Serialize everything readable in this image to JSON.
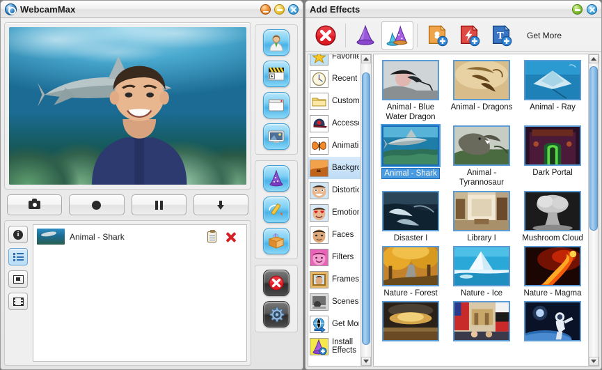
{
  "main_window": {
    "title": "WebcamMax",
    "logo_icon": "webcam-logo-icon",
    "window_buttons": [
      {
        "name": "minimize",
        "icon": "minimize-icon",
        "color": "#f0933a"
      },
      {
        "name": "maximize",
        "icon": "maximize-icon",
        "color": "#f3ce4c"
      },
      {
        "name": "close",
        "icon": "close-icon",
        "color": "#56b3e8"
      }
    ],
    "transport_buttons": [
      {
        "name": "snapshot",
        "icon": "camera-icon"
      },
      {
        "name": "record",
        "icon": "record-circle-icon"
      },
      {
        "name": "pause",
        "icon": "pause-icon"
      },
      {
        "name": "save",
        "icon": "arrow-down-icon"
      }
    ],
    "list_tabs": [
      {
        "name": "info",
        "icon": "info-icon",
        "selected": false
      },
      {
        "name": "effects-list",
        "icon": "list-icon",
        "selected": true
      },
      {
        "name": "pictures",
        "icon": "image-icon",
        "selected": false
      },
      {
        "name": "videos",
        "icon": "film-icon",
        "selected": false
      }
    ],
    "active_effects": [
      {
        "name": "Animal - Shark",
        "thumb": "shark-thumb",
        "actions": [
          "properties-icon",
          "delete-icon"
        ]
      }
    ],
    "rail_groups": [
      {
        "name": "sources",
        "buttons": [
          {
            "name": "webcam-source",
            "icon": "person-icon"
          },
          {
            "name": "video-source",
            "icon": "film-clapper-icon"
          },
          {
            "name": "window-source",
            "icon": "window-icon"
          },
          {
            "name": "desktop-source",
            "icon": "desktop-picture-icon"
          }
        ]
      },
      {
        "name": "effects-tools",
        "buttons": [
          {
            "name": "add-effects",
            "icon": "wizard-hat-icon"
          },
          {
            "name": "doodle",
            "icon": "pencil-icon"
          },
          {
            "name": "my-effects",
            "icon": "gift-box-icon"
          }
        ]
      },
      {
        "name": "app-actions",
        "buttons": [
          {
            "name": "exit",
            "icon": "red-x-icon"
          },
          {
            "name": "settings",
            "icon": "gear-icon"
          }
        ]
      }
    ],
    "preview": {
      "description": "Webcam preview with underwater shark background effect applied"
    }
  },
  "effects_panel": {
    "title": "Add Effects",
    "window_buttons": [
      {
        "name": "collapse",
        "icon": "collapse-icon",
        "color": "#8fc93c"
      },
      {
        "name": "close",
        "icon": "close-icon",
        "color": "#56b3e8"
      }
    ],
    "toolbar": {
      "buttons": [
        {
          "name": "remove-all-effects",
          "icon": "red-x-icon",
          "selected": false
        },
        {
          "name": "single-effect-mode",
          "icon": "purple-hat-icon",
          "selected": false
        },
        {
          "name": "multi-effect-mode",
          "icon": "multi-hat-icon",
          "selected": true
        },
        {
          "name": "add-picture",
          "icon": "add-picture-icon",
          "selected": false
        },
        {
          "name": "add-flash",
          "icon": "add-flash-icon",
          "selected": false
        },
        {
          "name": "add-text",
          "icon": "add-text-icon",
          "selected": false
        }
      ],
      "get_more_label": "Get More"
    },
    "categories": [
      {
        "label": "Favorites",
        "icon": "star-icon",
        "selected": false
      },
      {
        "label": "Recent",
        "icon": "clock-icon",
        "selected": false
      },
      {
        "label": "Custom",
        "icon": "folder-icon",
        "selected": false
      },
      {
        "label": "Accessories",
        "icon": "cap-icon",
        "selected": false
      },
      {
        "label": "Animations",
        "icon": "butterfly-icon",
        "selected": false
      },
      {
        "label": "Background",
        "icon": "desert-icon",
        "selected": true
      },
      {
        "label": "Distortions",
        "icon": "distorted-face-icon",
        "selected": false
      },
      {
        "label": "Emotions",
        "icon": "heart-eyes-icon",
        "selected": false
      },
      {
        "label": "Faces",
        "icon": "face-icon",
        "selected": false
      },
      {
        "label": "Filters",
        "icon": "pink-face-icon",
        "selected": false
      },
      {
        "label": "Frames",
        "icon": "frame-icon",
        "selected": false
      },
      {
        "label": "Scenes",
        "icon": "scene-icon",
        "selected": false
      },
      {
        "label": "Get More",
        "icon": "globe-arrow-icon",
        "selected": false
      },
      {
        "label": "Install Effects",
        "icon": "hat-plus-icon",
        "selected": false
      }
    ],
    "effects": [
      {
        "label": "Animal - Blue Water Dragon",
        "art": "blue-water-dragon",
        "selected": false
      },
      {
        "label": "Animal - Dragons",
        "art": "dragons",
        "selected": false
      },
      {
        "label": "Animal - Ray",
        "art": "ray",
        "selected": false
      },
      {
        "label": "Animal - Shark",
        "art": "shark",
        "selected": true
      },
      {
        "label": "Animal - Tyrannosaur",
        "art": "tyrannosaur",
        "selected": false
      },
      {
        "label": "Dark Portal",
        "art": "dark-portal",
        "selected": false
      },
      {
        "label": "Disaster I",
        "art": "disaster",
        "selected": false
      },
      {
        "label": "Library I",
        "art": "library",
        "selected": false
      },
      {
        "label": "Mushroom Cloud",
        "art": "mushroom-cloud",
        "selected": false
      },
      {
        "label": "Nature - Forest",
        "art": "forest",
        "selected": false
      },
      {
        "label": "Nature - Ice",
        "art": "ice",
        "selected": false
      },
      {
        "label": "Nature - Magma",
        "art": "magma",
        "selected": false
      },
      {
        "label": "",
        "art": "explosion",
        "selected": false
      },
      {
        "label": "",
        "art": "politics",
        "selected": false
      },
      {
        "label": "",
        "art": "astronaut",
        "selected": false
      }
    ],
    "category_scrollbar": {
      "thumb_top_pct": 3,
      "thumb_height_pct": 93
    },
    "grid_scrollbar": {
      "thumb_top_pct": 1,
      "thumb_height_pct": 56
    }
  }
}
